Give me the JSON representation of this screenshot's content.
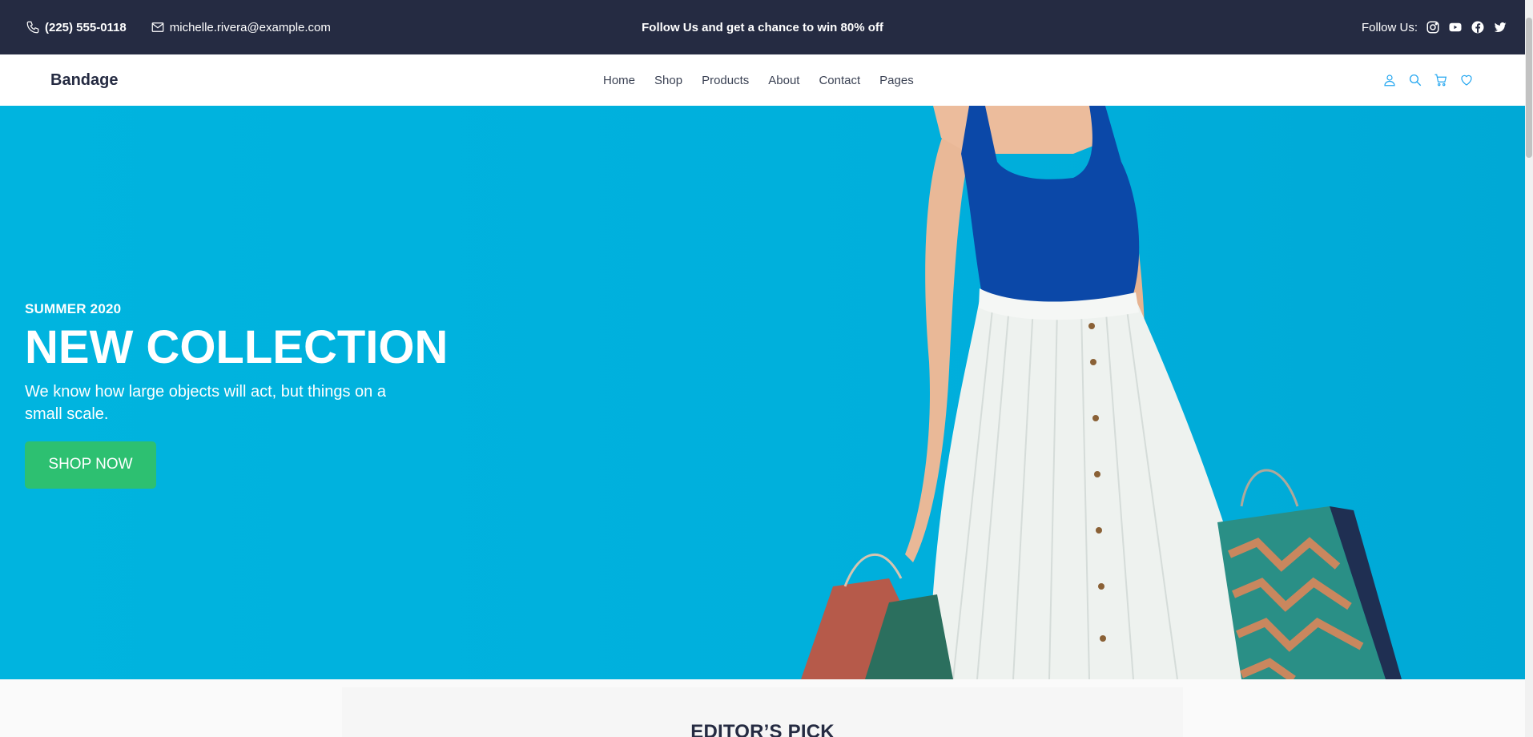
{
  "topbar": {
    "phone": "(225) 555-0118",
    "email": "michelle.rivera@example.com",
    "promo": "Follow Us  and get a chance to win 80% off",
    "follow_label": "Follow Us:",
    "social_icons": [
      "instagram-icon",
      "youtube-icon",
      "facebook-icon",
      "twitter-icon"
    ]
  },
  "navbar": {
    "brand": "Bandage",
    "links": [
      "Home",
      "Shop",
      "Products",
      "About",
      "Contact",
      "Pages"
    ],
    "icons": [
      "user-icon",
      "search-icon",
      "cart-icon",
      "heart-icon"
    ]
  },
  "hero": {
    "season": "SUMMER 2020",
    "headline": "NEW COLLECTION",
    "subtext": "We know how large objects will act, but things on a small scale.",
    "cta": "SHOP NOW"
  },
  "editors_pick": {
    "title": "EDITOR’S PICK"
  },
  "colors": {
    "topbar_bg": "#252b42",
    "hero_bg": "#00b0dd",
    "cta_bg": "#2dc071",
    "accent": "#23a6f0"
  }
}
